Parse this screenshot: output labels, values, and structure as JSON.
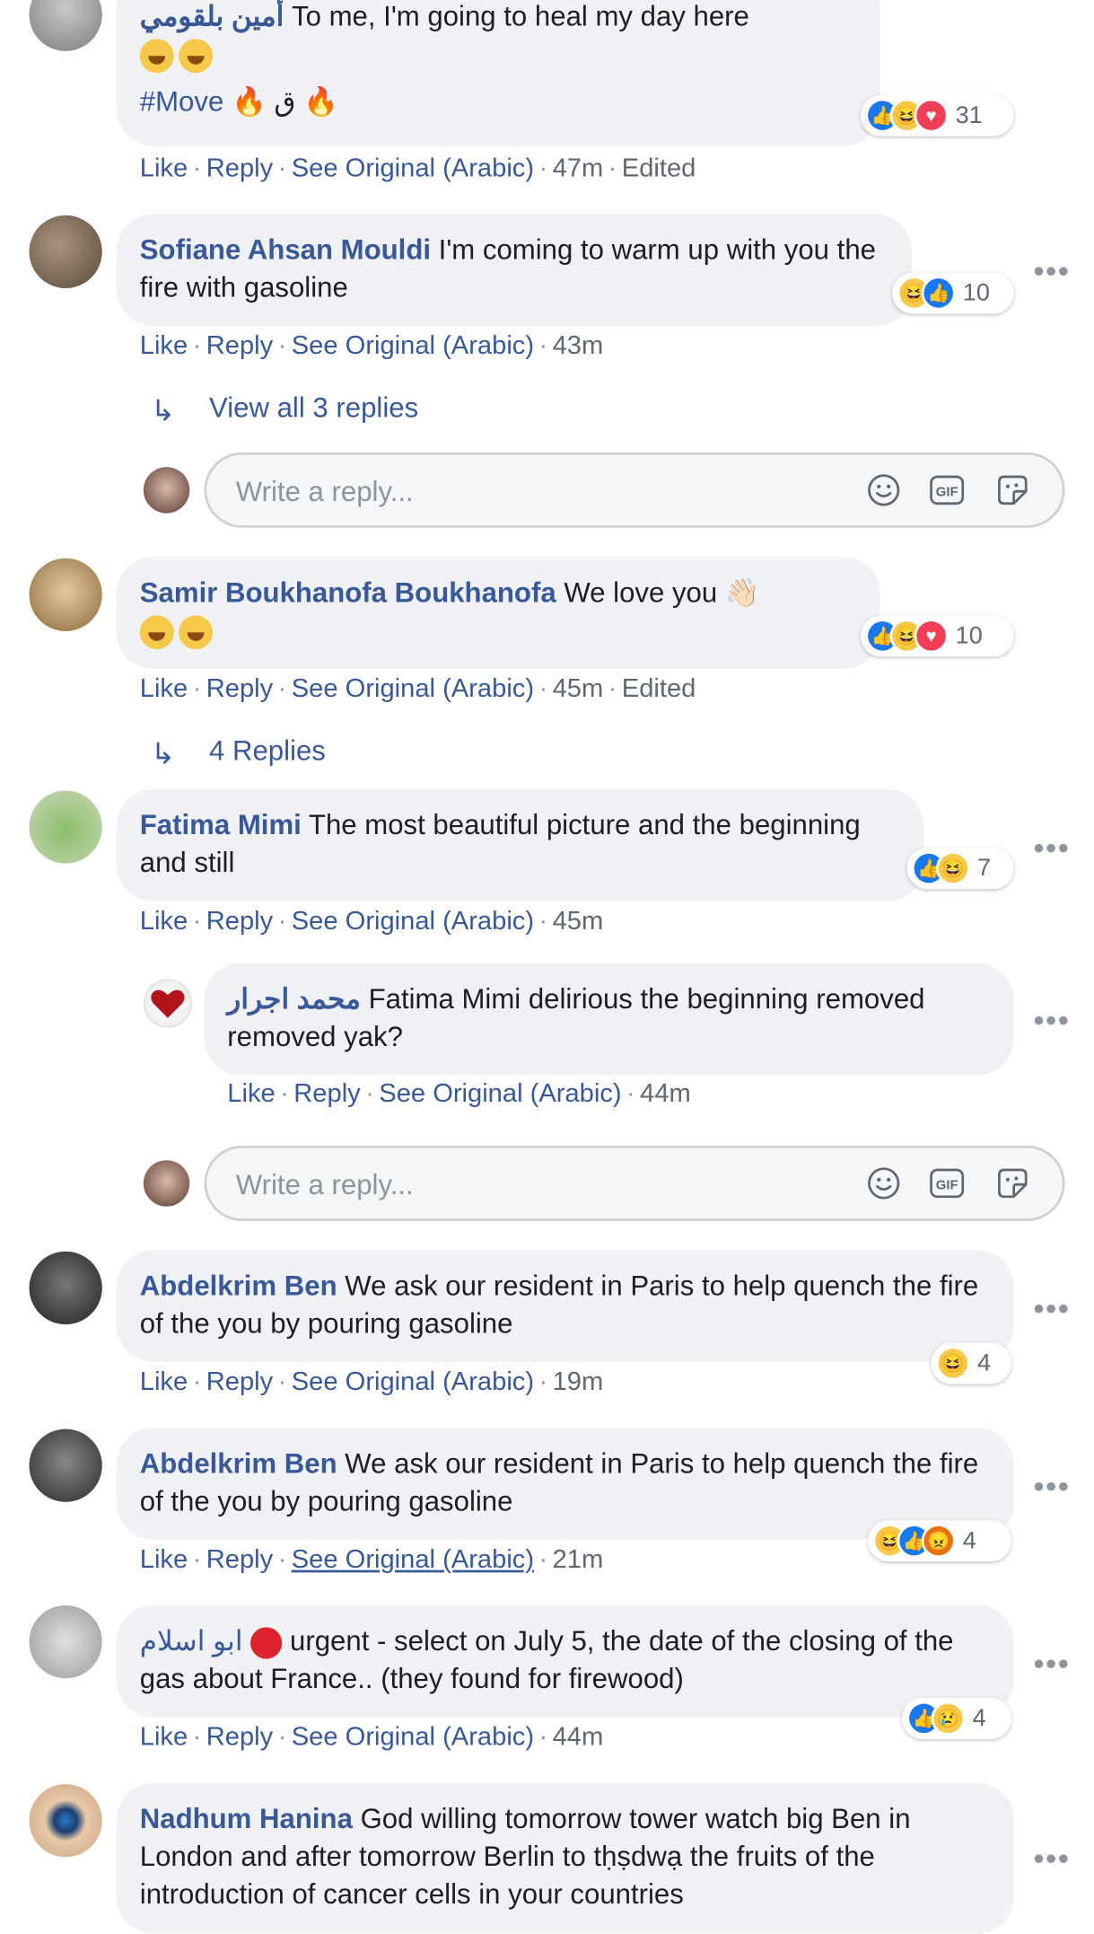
{
  "comments": [
    {
      "name": "أمين بلقومي",
      "text": "To me, I'm going to heal my day here",
      "line2": "",
      "hashtag": "#Move",
      "arabic_char": "ق",
      "reactions": "31",
      "actions": {
        "like": "Like",
        "reply": "Reply",
        "see": "See Original (Arabic)",
        "time": "47m",
        "edited": "Edited"
      }
    },
    {
      "name": "Sofiane Ahsan Mouldi",
      "text": "I'm coming to warm up with you the fire with gasoline",
      "reactions": "10",
      "actions": {
        "like": "Like",
        "reply": "Reply",
        "see": "See Original (Arabic)",
        "time": "43m"
      }
    },
    {
      "name": "Samir Boukhanofa Boukhanofa",
      "text": "We love you",
      "reactions": "10",
      "actions": {
        "like": "Like",
        "reply": "Reply",
        "see": "See Original (Arabic)",
        "time": "45m",
        "edited": "Edited"
      }
    },
    {
      "name": "Fatima Mimi",
      "text": "The most beautiful picture and the beginning and still",
      "reactions": "7",
      "actions": {
        "like": "Like",
        "reply": "Reply",
        "see": "See Original (Arabic)",
        "time": "45m"
      }
    },
    {
      "name": "محمد اجرار",
      "text": "Fatima Mimi delirious the beginning removed removed yak?",
      "actions": {
        "like": "Like",
        "reply": "Reply",
        "see": "See Original (Arabic)",
        "time": "44m"
      }
    },
    {
      "name": "Abdelkrim Ben",
      "text": "We ask our resident in Paris to help quench the fire of the you by pouring gasoline",
      "reactions": "4",
      "actions": {
        "like": "Like",
        "reply": "Reply",
        "see": "See Original (Arabic)",
        "time": "19m"
      }
    },
    {
      "name": "Abdelkrim Ben",
      "text": "We ask our resident in Paris to help quench the fire of the you by pouring gasoline",
      "reactions": "4",
      "actions": {
        "like": "Like",
        "reply": "Reply",
        "see": "See Original (Arabic)",
        "time": "21m"
      }
    },
    {
      "name": "ابو اسلام",
      "text": "urgent - select on July 5, the date of the closing of the gas about France.. (they found for firewood)",
      "reactions": "4",
      "actions": {
        "like": "Like",
        "reply": "Reply",
        "see": "See Original (Arabic)",
        "time": "44m"
      }
    },
    {
      "name": "Nadhum Hanina",
      "text": "God willing tomorrow tower watch big Ben in London and after tomorrow Berlin to tḥṣdwạ the fruits of the introduction of cancer cells in your countries"
    }
  ],
  "view_replies_1": "View all 3 replies",
  "view_replies_2": "4 Replies",
  "reply_placeholder": "Write a reply...",
  "gif_label": "GIF",
  "colors": {
    "link": "#385898",
    "bubble": "#f0f1f4",
    "meta": "#606770",
    "like": "#1877f2",
    "love": "#f33e58",
    "haha": "#f7c94a"
  }
}
